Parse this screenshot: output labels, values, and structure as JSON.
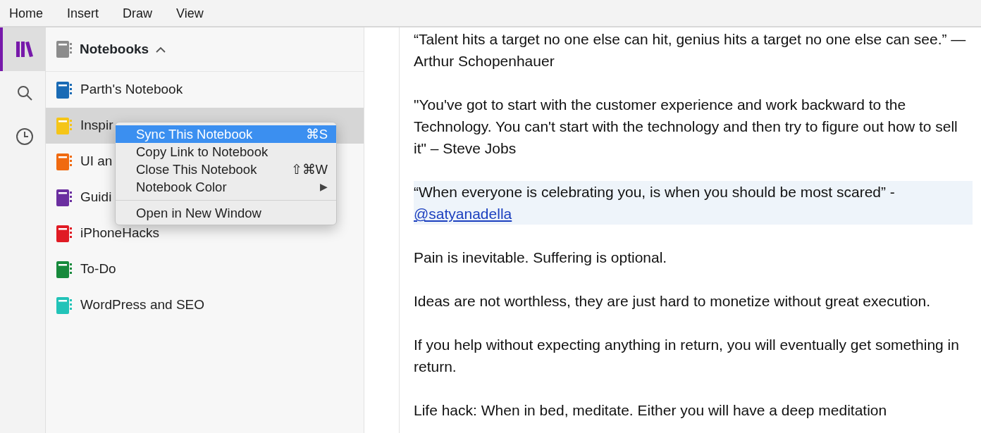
{
  "menu_bar": [
    "Home",
    "Insert",
    "Draw",
    "View"
  ],
  "rail": [
    {
      "kind": "notebooks",
      "selected": true
    },
    {
      "kind": "search",
      "selected": false
    },
    {
      "kind": "recent",
      "selected": false
    }
  ],
  "notebooks_header": {
    "title": "Notebooks",
    "expanded": true
  },
  "notebooks": [
    {
      "name": "Parth's Notebook",
      "color": "#1a6bb5",
      "selected": false
    },
    {
      "name": "Inspir",
      "color": "#f5c518",
      "selected": true
    },
    {
      "name": "UI an",
      "color": "#f06a10",
      "selected": false
    },
    {
      "name": "Guidi",
      "color": "#6b2fa0",
      "selected": false
    },
    {
      "name": "iPhoneHacks",
      "color": "#e01b24",
      "selected": false
    },
    {
      "name": "To-Do",
      "color": "#178a3c",
      "selected": false
    },
    {
      "name": "WordPress and SEO",
      "color": "#22c3b8",
      "selected": false
    }
  ],
  "context_menu": [
    {
      "kind": "item",
      "label": "Sync This Notebook",
      "shortcut": "⌘S",
      "selected": true
    },
    {
      "kind": "item",
      "label": "Copy Link to Notebook",
      "selected": false
    },
    {
      "kind": "item",
      "label": "Close This Notebook",
      "shortcut": "⇧⌘W",
      "selected": false
    },
    {
      "kind": "submenu",
      "label": "Notebook Color",
      "arrow": "▶",
      "selected": false
    },
    {
      "kind": "separator"
    },
    {
      "kind": "item",
      "label": "Open in New Window",
      "selected": false
    }
  ],
  "page": [
    {
      "text": "“Talent hits a target no one else can hit, genius hits a target no one else can see.” — Arthur Schopenhauer",
      "highlighted": false
    },
    {
      "text": "\"You've got to start with the customer experience and work backward to the Technology. You can't start with the technology and then try to figure out how to sell it\" – Steve Jobs",
      "highlighted": false
    },
    {
      "text": "“When everyone is celebrating you, is when you should be most scared” -",
      "link": "@satyanadella",
      "highlighted": true
    },
    {
      "text": "Pain is inevitable. Suffering is optional.",
      "highlighted": false
    },
    {
      "text": "Ideas are not worthless, they are just hard to monetize without great execution.",
      "highlighted": false
    },
    {
      "text": "If you help without expecting anything in return, you will eventually get something in return.",
      "highlighted": false
    },
    {
      "text": "Life hack: When in bed, meditate. Either you will have a deep meditation",
      "highlighted": false
    }
  ]
}
